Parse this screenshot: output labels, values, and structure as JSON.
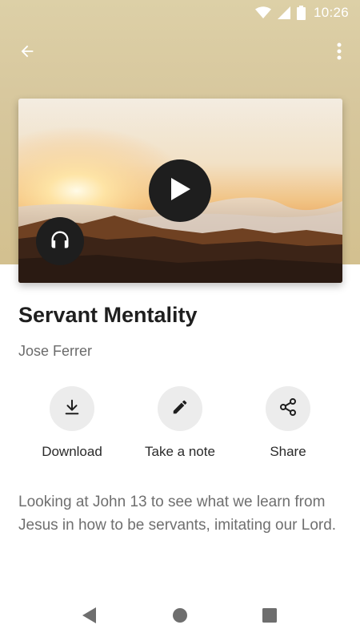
{
  "status_bar": {
    "time": "10:26",
    "icons": [
      "wifi-icon",
      "cell-signal-icon",
      "battery-icon"
    ]
  },
  "app_bar": {
    "back_icon": "arrow-back-icon",
    "menu_icon": "more-vert-icon"
  },
  "media": {
    "play_icon": "play-icon",
    "audio_icon": "headphones-icon"
  },
  "sermon": {
    "title": "Servant Mentality",
    "author": "Jose Ferrer",
    "description": "Looking at John 13 to see what we learn from Jesus in how to be servants, imitating our Lord."
  },
  "actions": [
    {
      "label": "Download",
      "icon": "download-icon"
    },
    {
      "label": "Take a note",
      "icon": "pencil-icon"
    },
    {
      "label": "Share",
      "icon": "share-icon"
    }
  ],
  "nav_bar": {
    "icons": [
      "back-triangle-icon",
      "home-circle-icon",
      "recents-square-icon"
    ]
  },
  "colors": {
    "hero_background": "#d7c79d",
    "button_dark": "#1e1e1e",
    "action_circle": "#ececec"
  }
}
